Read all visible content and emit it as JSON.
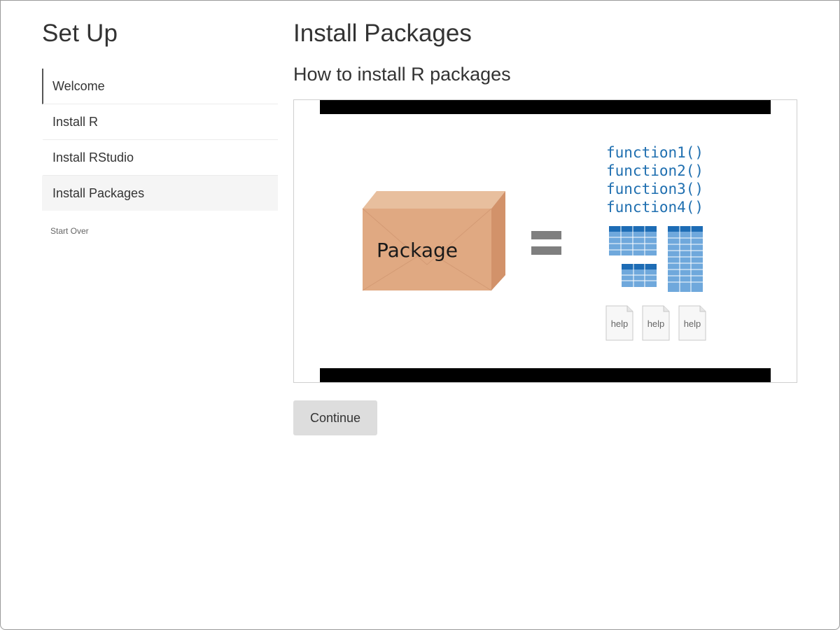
{
  "sidebar": {
    "title": "Set Up",
    "items": [
      {
        "label": "Welcome"
      },
      {
        "label": "Install R"
      },
      {
        "label": "Install RStudio"
      },
      {
        "label": "Install Packages"
      }
    ],
    "start_over": "Start Over"
  },
  "main": {
    "title": "Install Packages",
    "subtitle": "How to install R packages",
    "video": {
      "package_label": "Package",
      "functions": [
        "function1()",
        "function2()",
        "function3()",
        "function4()"
      ],
      "help_labels": [
        "help",
        "help",
        "help"
      ]
    },
    "continue_label": "Continue"
  },
  "colors": {
    "box": "#e0a982",
    "function_text": "#1f6fb0",
    "table_header": "#1d6cb5",
    "table_cell": "#6fa8dc",
    "equals": "#7f7f7f"
  }
}
